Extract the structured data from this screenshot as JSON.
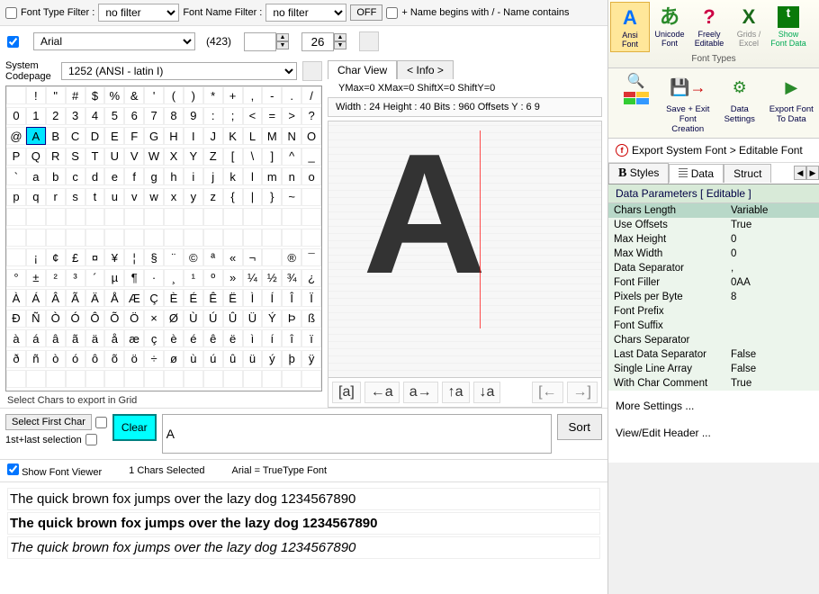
{
  "filter": {
    "type_label": "Font Type Filter :",
    "type_value": "no filter",
    "name_label": "Font Name Filter :",
    "name_value": "no filter",
    "off_label": "OFF",
    "search_hint": "+ Name begins with / - Name contains"
  },
  "font": {
    "name": "Arial",
    "count": "(423)",
    "size": "26"
  },
  "codepage": {
    "label": "System Codepage",
    "value": "1252  (ANSI - latin I)"
  },
  "char_rows": [
    [
      "",
      "!",
      "\"",
      "#",
      "$",
      "%",
      "&",
      "'",
      "(",
      ")",
      "*",
      "+",
      ",",
      "-",
      ".",
      "/"
    ],
    [
      "0",
      "1",
      "2",
      "3",
      "4",
      "5",
      "6",
      "7",
      "8",
      "9",
      ":",
      ";",
      "<",
      "=",
      ">",
      "?"
    ],
    [
      "@",
      "A",
      "B",
      "C",
      "D",
      "E",
      "F",
      "G",
      "H",
      "I",
      "J",
      "K",
      "L",
      "M",
      "N",
      "O"
    ],
    [
      "P",
      "Q",
      "R",
      "S",
      "T",
      "U",
      "V",
      "W",
      "X",
      "Y",
      "Z",
      "[",
      "\\",
      "]",
      "^",
      "_"
    ],
    [
      "`",
      "a",
      "b",
      "c",
      "d",
      "e",
      "f",
      "g",
      "h",
      "i",
      "j",
      "k",
      "l",
      "m",
      "n",
      "o"
    ],
    [
      "p",
      "q",
      "r",
      "s",
      "t",
      "u",
      "v",
      "w",
      "x",
      "y",
      "z",
      "{",
      "|",
      "}",
      "~",
      ""
    ],
    [
      "",
      "",
      "",
      "",
      "",
      "",
      "",
      "",
      "",
      "",
      "",
      "",
      "",
      "",
      "",
      ""
    ],
    [
      "",
      "",
      "",
      "",
      "",
      "",
      "",
      "",
      "",
      "",
      "",
      "",
      "",
      "",
      "",
      ""
    ],
    [
      "",
      "¡",
      "¢",
      "£",
      "¤",
      "¥",
      "¦",
      "§",
      "¨",
      "©",
      "ª",
      "«",
      "¬",
      "",
      "®",
      "¯"
    ],
    [
      "°",
      "±",
      "²",
      "³",
      "´",
      "µ",
      "¶",
      "·",
      "¸",
      "¹",
      "º",
      "»",
      "¼",
      "½",
      "¾",
      "¿"
    ],
    [
      "À",
      "Á",
      "Â",
      "Ã",
      "Ä",
      "Å",
      "Æ",
      "Ç",
      "È",
      "É",
      "Ê",
      "Ë",
      "Ì",
      "Í",
      "Î",
      "Ï"
    ],
    [
      "Ð",
      "Ñ",
      "Ò",
      "Ó",
      "Ô",
      "Õ",
      "Ö",
      "×",
      "Ø",
      "Ù",
      "Ú",
      "Û",
      "Ü",
      "Ý",
      "Þ",
      "ß"
    ],
    [
      "à",
      "á",
      "â",
      "ã",
      "ä",
      "å",
      "æ",
      "ç",
      "è",
      "é",
      "ê",
      "ë",
      "ì",
      "í",
      "î",
      "ï"
    ],
    [
      "ð",
      "ñ",
      "ò",
      "ó",
      "ô",
      "õ",
      "ö",
      "÷",
      "ø",
      "ù",
      "ú",
      "û",
      "ü",
      "ý",
      "þ",
      "ÿ"
    ],
    [
      "",
      "",
      "",
      "",
      "",
      "",
      "",
      "",
      "",
      "",
      "",
      "",
      "",
      "",
      "",
      ""
    ]
  ],
  "selected_row": 2,
  "selected_col": 1,
  "selected_glyph": "A",
  "grid_help": "Select Chars to export in Grid",
  "charview": {
    "tab_view": "Char View",
    "tab_info": "< Info >",
    "metrics": "YMax=0  XMax=0  ShiftX=0  ShiftY=0",
    "dims": "Width : 24  Height : 40  Bits : 960  Offsets Y : 6 9",
    "toolbar": {
      "t1": "[a]",
      "t2": "←a",
      "t3": "a→",
      "t4": "↑a",
      "t5": "↓a",
      "nav_prev": "[←",
      "nav_next": "→]"
    }
  },
  "lower": {
    "select_first": "Select First Char",
    "first_last": "1st+last selection",
    "clear": "Clear",
    "chars_value": "A",
    "sort": "Sort",
    "show_font_viewer": "Show Font Viewer",
    "chars_selected": "1 Chars Selected",
    "font_type": "Arial = TrueType Font",
    "pangram": "The quick brown fox jumps over the lazy dog 1234567890"
  },
  "ribbon": {
    "ansi": "Ansi Font",
    "unicode": "Unicode Font",
    "free": "Freely Editable",
    "grids": "Grids / Excel",
    "data": "Show Font Data",
    "group": "Font Types"
  },
  "ribbon2": {
    "save": "Save + Exit Font Creation",
    "settings": "Data Settings",
    "export": "Export Font To Data"
  },
  "export_header": {
    "label": "Export System Font > Editable Font"
  },
  "rtabs": {
    "styles": "Styles",
    "data": "Data",
    "struct": "Struct"
  },
  "params_header": "Data Parameters [ Editable ]",
  "params": [
    {
      "k": "Chars Length",
      "v": "Variable"
    },
    {
      "k": "Use Offsets",
      "v": "True"
    },
    {
      "k": "Max Height",
      "v": "0"
    },
    {
      "k": "Max Width",
      "v": "0"
    },
    {
      "k": "Data Separator",
      "v": ","
    },
    {
      "k": "Font Filler",
      "v": "0AA"
    },
    {
      "k": "Pixels per Byte",
      "v": "8"
    },
    {
      "k": "Font Prefix",
      "v": ""
    },
    {
      "k": "Font Suffix",
      "v": ""
    },
    {
      "k": "Chars Separator",
      "v": ""
    },
    {
      "k": "Last Data Separator",
      "v": "False"
    },
    {
      "k": "Single Line Array",
      "v": "False"
    },
    {
      "k": "With Char Comment",
      "v": "True"
    }
  ],
  "more": {
    "more": "More Settings ...",
    "view": "View/Edit Header ..."
  }
}
